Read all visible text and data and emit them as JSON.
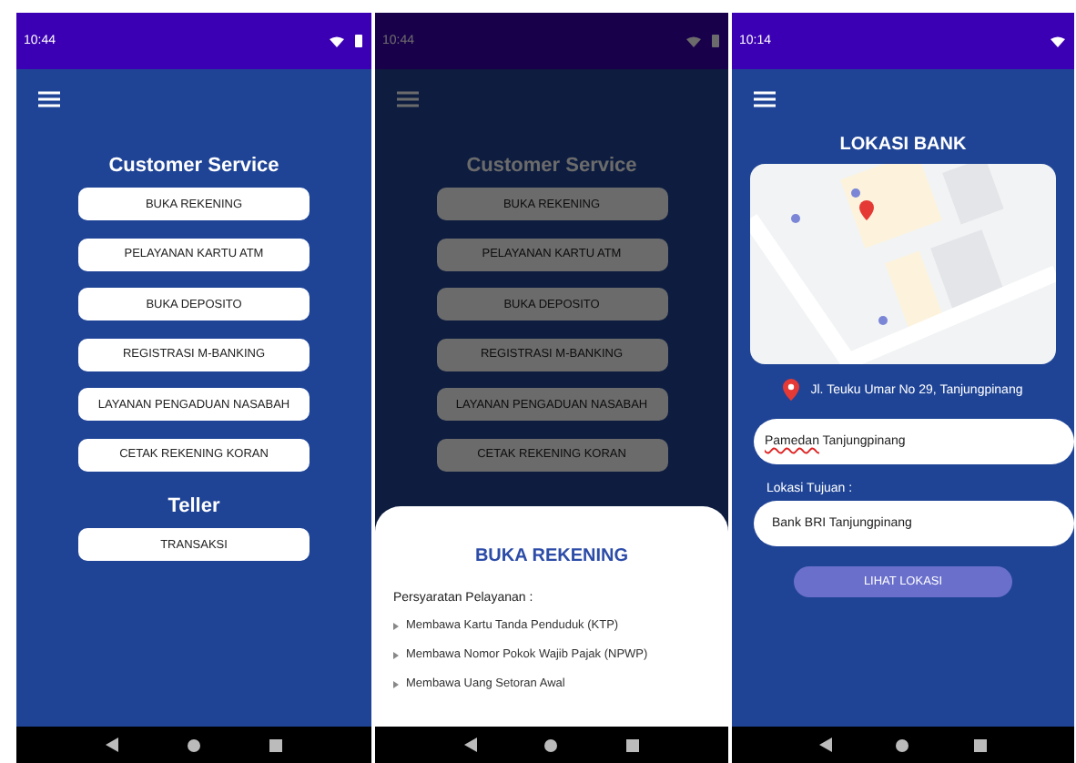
{
  "screens": [
    {
      "kind": "menu",
      "status": {
        "time": "10:44",
        "battery": true
      },
      "sections": [
        {
          "heading": "Customer Service",
          "buttons": [
            "BUKA REKENING",
            "PELAYANAN KARTU ATM",
            "BUKA DEPOSITO",
            "REGISTRASI M-BANKING",
            "LAYANAN PENGADUAN NASABAH",
            "CETAK REKENING KORAN"
          ]
        },
        {
          "heading": "Teller",
          "buttons": [
            "TRANSAKSI"
          ]
        }
      ]
    },
    {
      "kind": "menu",
      "status": {
        "time": "10:44",
        "battery": true
      },
      "sections": [
        {
          "heading": "Customer Service",
          "buttons": [
            "BUKA REKENING",
            "PELAYANAN KARTU ATM",
            "BUKA DEPOSITO",
            "REGISTRASI M-BANKING",
            "LAYANAN PENGADUAN NASABAH",
            "CETAK REKENING KORAN"
          ]
        }
      ],
      "sheet": {
        "title": "BUKA REKENING",
        "subtitle": "Persyaratan Pelayanan :",
        "items": [
          "Membawa Kartu Tanda Penduduk (KTP)",
          "Membawa Nomor Pokok Wajib Pajak (NPWP)",
          "Membawa Uang Setoran Awal"
        ]
      }
    },
    {
      "kind": "location",
      "status": {
        "time": "10:14",
        "battery": false
      },
      "title": "LOKASI BANK",
      "address": "Jl. Teuku Umar No 29, Tanjungpinang",
      "origin": [
        {
          "text": "Pamedan",
          "misspelled": true
        },
        {
          "text": " Tanjungpinang",
          "misspelled": false
        }
      ],
      "destination_label": "Lokasi Tujuan :",
      "destination": "Bank BRI Tanjungpinang",
      "button": "LIHAT LOKASI"
    }
  ]
}
